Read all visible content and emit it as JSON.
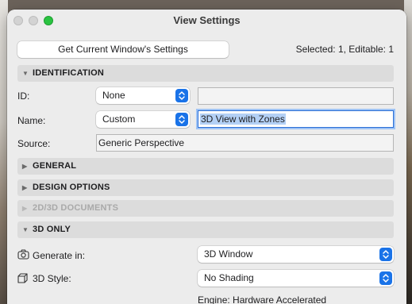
{
  "window": {
    "title": "View Settings"
  },
  "toolbar": {
    "get_settings_label": "Get Current Window's Settings",
    "selection_info": "Selected: 1, Editable: 1"
  },
  "sections": {
    "identification": "IDENTIFICATION",
    "general": "GENERAL",
    "design_options": "DESIGN OPTIONS",
    "docs_2d3d": "2D/3D DOCUMENTS",
    "only_3d": "3D ONLY"
  },
  "identification": {
    "id_label": "ID:",
    "id_popup": "None",
    "id_value": "",
    "name_label": "Name:",
    "name_popup": "Custom",
    "name_value": "3D View with Zones",
    "source_label": "Source:",
    "source_value": "Generic Perspective"
  },
  "only_3d": {
    "generate_label": "Generate in:",
    "generate_value": "3D Window",
    "style_label": "3D Style:",
    "style_value": "No Shading",
    "engine_text": "Engine: Hardware Accelerated"
  },
  "colors": {
    "accent": "#1a73e8",
    "selection": "#b3d0f5",
    "section_bg": "#dcdcdc"
  },
  "icons": [
    "camera-icon",
    "cube-icon",
    "disclosure-triangle-icon",
    "stepper-icon"
  ]
}
